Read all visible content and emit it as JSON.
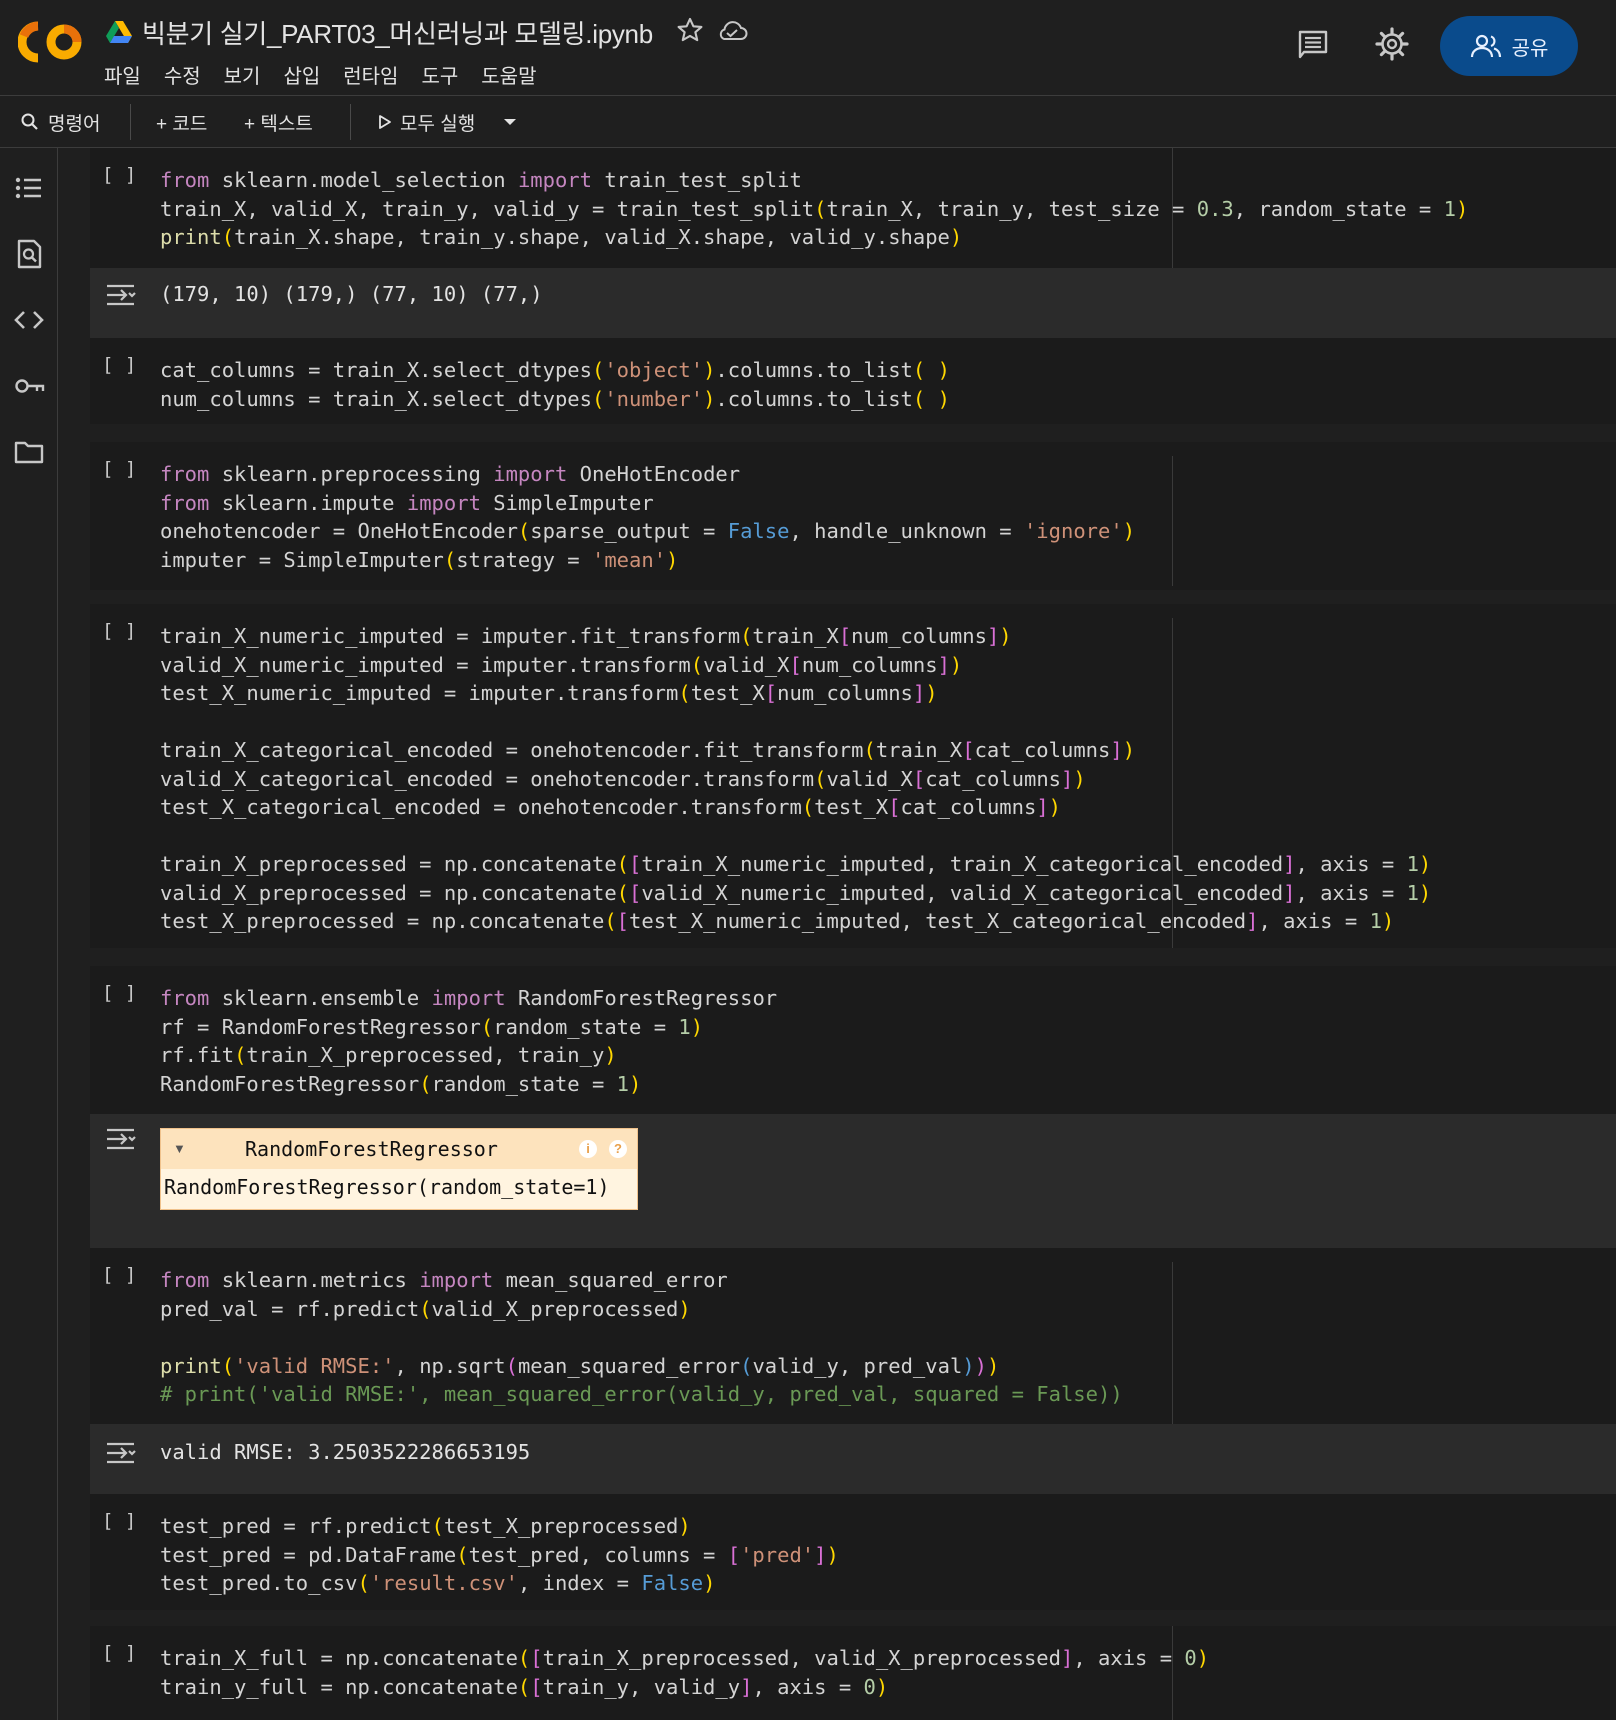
{
  "header": {
    "notebook_title": "빅분기 실기_PART03_머신러닝과 모델링.ipynb",
    "menu": [
      "파일",
      "수정",
      "보기",
      "삽입",
      "런타임",
      "도구",
      "도움말"
    ],
    "share_label": "공유"
  },
  "toolbar": {
    "commands_label": "명령어",
    "add_code_label": "+ 코드",
    "add_text_label": "+ 텍스트",
    "run_all_label": "모두 실행"
  },
  "left_rail": {
    "icons": [
      "table-of-contents-icon",
      "find-replace-icon",
      "code-snippets-icon",
      "secrets-key-icon",
      "files-folder-icon"
    ]
  },
  "cells": [
    {
      "run_label": "[ ]",
      "code": [
        "from sklearn.model_selection import train_test_split",
        "train_X, valid_X, train_y, valid_y = train_test_split(train_X, train_y, test_size = 0.3, random_state = 1)",
        "print(train_X.shape, train_y.shape, valid_X.shape, valid_y.shape)"
      ],
      "output": "(179, 10) (179,) (77, 10) (77,)"
    },
    {
      "run_label": "[ ]",
      "code": [
        "cat_columns = train_X.select_dtypes('object').columns.to_list( )",
        "num_columns = train_X.select_dtypes('number').columns.to_list( )"
      ]
    },
    {
      "run_label": "[ ]",
      "code": [
        "from sklearn.preprocessing import OneHotEncoder",
        "from sklearn.impute import SimpleImputer",
        "onehotencoder = OneHotEncoder(sparse_output = False, handle_unknown = 'ignore')",
        "imputer = SimpleImputer(strategy = 'mean')"
      ]
    },
    {
      "run_label": "[ ]",
      "code": [
        "train_X_numeric_imputed = imputer.fit_transform(train_X[num_columns])",
        "valid_X_numeric_imputed = imputer.transform(valid_X[num_columns])",
        "test_X_numeric_imputed = imputer.transform(test_X[num_columns])",
        "",
        "train_X_categorical_encoded = onehotencoder.fit_transform(train_X[cat_columns])",
        "valid_X_categorical_encoded = onehotencoder.transform(valid_X[cat_columns])",
        "test_X_categorical_encoded = onehotencoder.transform(test_X[cat_columns])",
        "",
        "train_X_preprocessed = np.concatenate([train_X_numeric_imputed, train_X_categorical_encoded], axis = 1)",
        "valid_X_preprocessed = np.concatenate([valid_X_numeric_imputed, valid_X_categorical_encoded], axis = 1)",
        "test_X_preprocessed = np.concatenate([test_X_numeric_imputed, test_X_categorical_encoded], axis = 1)"
      ]
    },
    {
      "run_label": "[ ]",
      "code": [
        "from sklearn.ensemble import RandomForestRegressor",
        "rf = RandomForestRegressor(random_state = 1)",
        "rf.fit(train_X_preprocessed, train_y)",
        "RandomForestRegressor(random_state = 1)"
      ],
      "widget": {
        "title": "RandomForestRegressor",
        "info_badge": "i",
        "help_badge": "?",
        "repr": "RandomForestRegressor(random_state=1)"
      }
    },
    {
      "run_label": "[ ]",
      "code": [
        "from sklearn.metrics import mean_squared_error",
        "pred_val = rf.predict(valid_X_preprocessed)",
        "",
        "print('valid RMSE:', np.sqrt(mean_squared_error(valid_y, pred_val)))",
        "# print('valid RMSE:', mean_squared_error(valid_y, pred_val, squared = False))"
      ],
      "output": "valid RMSE: 3.2503522286653195"
    },
    {
      "run_label": "[ ]",
      "code": [
        "test_pred = rf.predict(test_X_preprocessed)",
        "test_pred = pd.DataFrame(test_pred, columns = ['pred'])",
        "test_pred.to_csv('result.csv', index = False)"
      ]
    },
    {
      "run_label": "[ ]",
      "code": [
        "train_X_full = np.concatenate([train_X_preprocessed, valid_X_preprocessed], axis = 0)",
        "train_y_full = np.concatenate([train_y, valid_y], axis = 0)"
      ]
    }
  ],
  "colors": {
    "background": "#1f1f1f",
    "cell_background": "#1b1b1b",
    "output_background": "#2b2b2b",
    "share_button": "#0a4b8c",
    "keyword": "#c586c0",
    "string": "#ce9178",
    "number": "#b5cea8",
    "boolean": "#569cd6",
    "comment": "#6a9955",
    "widget_header": "#fde3bd"
  }
}
